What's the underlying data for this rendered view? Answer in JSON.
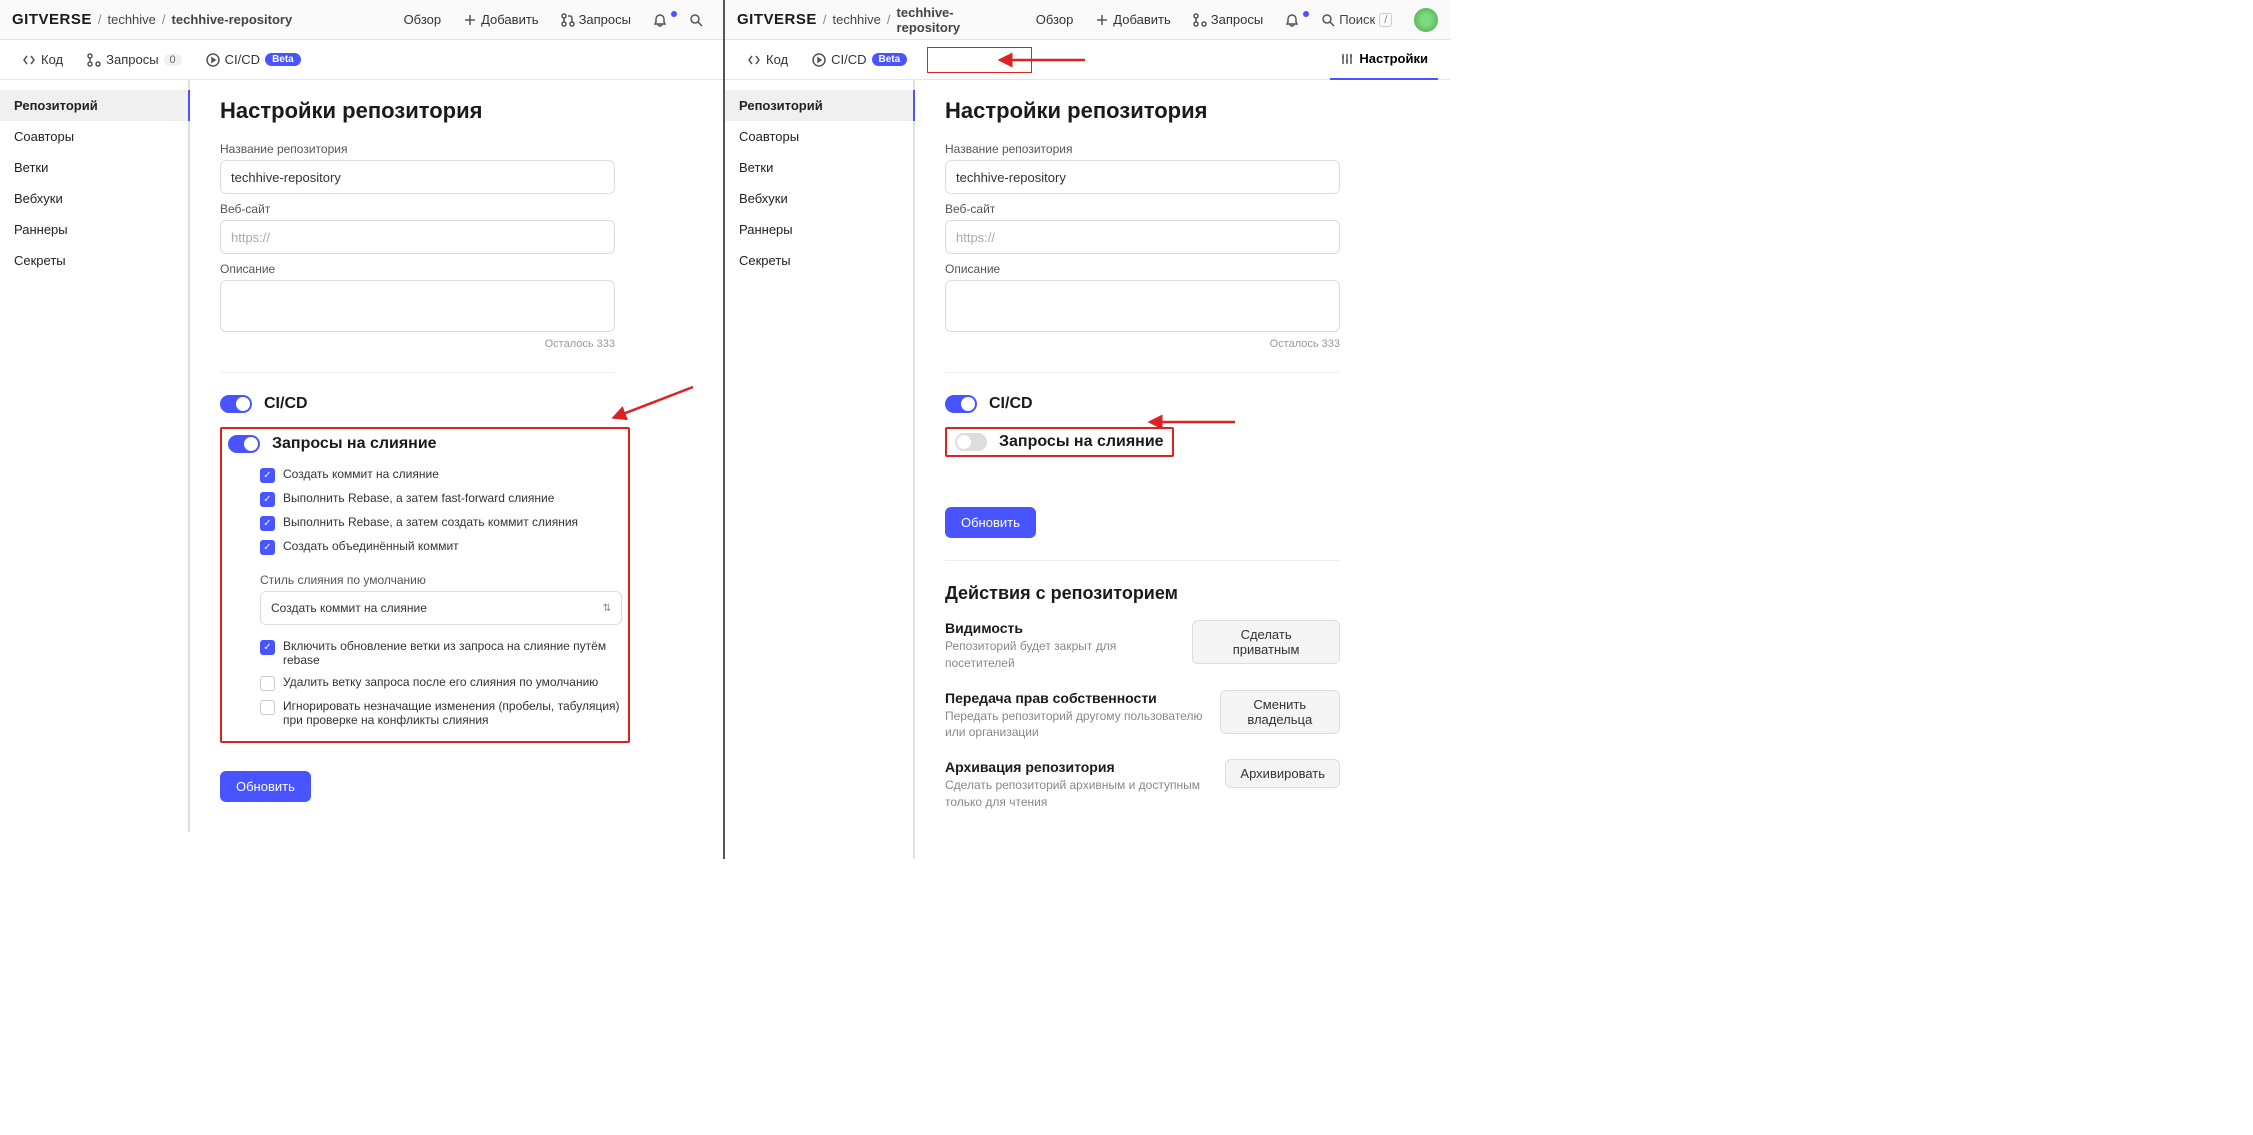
{
  "brand": "GITVERSE",
  "breadcrumb": {
    "owner": "techhive",
    "repo": "techhive-repository"
  },
  "topnav": {
    "overview": "Обзор",
    "add": "Добавить",
    "requests": "Запросы",
    "search": "Поиск",
    "searchKey": "/"
  },
  "subnav": {
    "code": "Код",
    "requests": "Запросы",
    "requestsCount": "0",
    "cicd": "CI/CD",
    "beta": "Beta",
    "settings": "Настройки"
  },
  "sidebar": {
    "items": [
      "Репозиторий",
      "Соавторы",
      "Ветки",
      "Вебхуки",
      "Раннеры",
      "Секреты"
    ]
  },
  "settings": {
    "title": "Настройки репозитория",
    "nameLabel": "Название репозитория",
    "nameValue": "techhive-repository",
    "siteLabel": "Веб-сайт",
    "sitePlaceholder": "https://",
    "descLabel": "Описание",
    "counter": "Осталось 333",
    "cicdLabel": "CI/CD",
    "mergeLabel": "Запросы на слияние",
    "opts": {
      "c1": "Создать коммит на слияние",
      "c2": "Выполнить Rebase, а затем fast-forward слияние",
      "c3": "Выполнить Rebase, а затем создать коммит слияния",
      "c4": "Создать объединённый коммит",
      "styleLabel": "Стиль слияния по умолчанию",
      "styleValue": "Создать коммит на слияние",
      "c5": "Включить обновление ветки из запроса на слияние путём rebase",
      "c6": "Удалить ветку запроса после его слияния по умолчанию",
      "c7": "Игнорировать незначащие изменения (пробелы, табуляция) при проверке на конфликты слияния"
    },
    "update": "Обновить"
  },
  "actions": {
    "title": "Действия с репозиторием",
    "vis": {
      "t": "Видимость",
      "d": "Репозиторий будет закрыт для посетителей",
      "b": "Сделать приватным"
    },
    "own": {
      "t": "Передача прав собственности",
      "d": "Передать репозиторий другому пользователю или организации",
      "b": "Сменить владельца"
    },
    "arc": {
      "t": "Архивация репозитория",
      "d": "Сделать репозиторий архивным и доступным только для чтения",
      "b": "Архивировать"
    }
  }
}
